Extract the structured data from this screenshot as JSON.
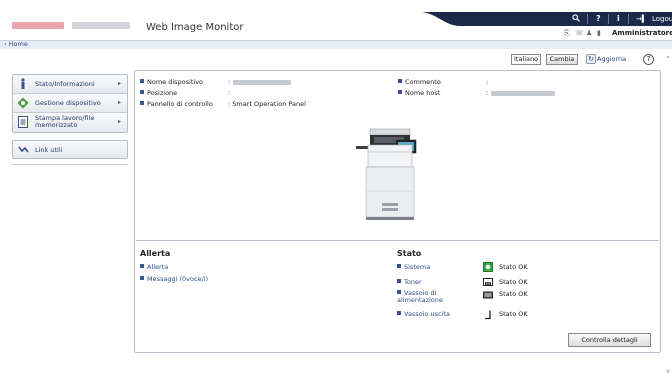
{
  "header": {
    "app_title": "Web Image Monitor",
    "logout_label": "Logout",
    "user_name": "Amministratore",
    "brand_color": "#1b2a4a"
  },
  "breadcrumb": {
    "home_label": "‹ Home"
  },
  "sidebar": {
    "items": [
      {
        "label": "Stato/Informazioni",
        "icon": "info-icon"
      },
      {
        "label": "Gestione dispositivo",
        "icon": "device-management-icon"
      },
      {
        "label": "Stampa lavoro/file memorizzato",
        "icon": "stored-file-icon"
      }
    ],
    "links_label": "Link utili"
  },
  "toolbar": {
    "language_value": "Italiano",
    "change_label": "Cambia",
    "refresh_label": "Aggiorna",
    "help_label": "?"
  },
  "device_info": {
    "left": [
      {
        "label": "Nome dispositivo",
        "value": ""
      },
      {
        "label": "Posizione",
        "value": ""
      },
      {
        "label": "Pannello di controllo",
        "value": ": Smart Operation Panel"
      }
    ],
    "right": [
      {
        "label": "Commento",
        "value": ""
      },
      {
        "label": "Nome host",
        "value": ""
      }
    ]
  },
  "alerts": {
    "title": "Allerta",
    "links": [
      "Allerta",
      "Messaggi (0voce/i)"
    ]
  },
  "status": {
    "title": "Stato",
    "rows": [
      {
        "label": "Sistema",
        "status": "Stato OK",
        "icon": "system-ok-icon"
      },
      {
        "label": "Toner",
        "status": "Stato OK",
        "icon": "toner-icon"
      },
      {
        "label": "Vassoio di alimentazione",
        "status": "Stato OK",
        "icon": "paper-tray-icon"
      },
      {
        "label": "Vassoio uscita",
        "status": "Stato OK",
        "icon": "output-tray-icon"
      }
    ]
  },
  "details_button": "Controlla dettagli"
}
